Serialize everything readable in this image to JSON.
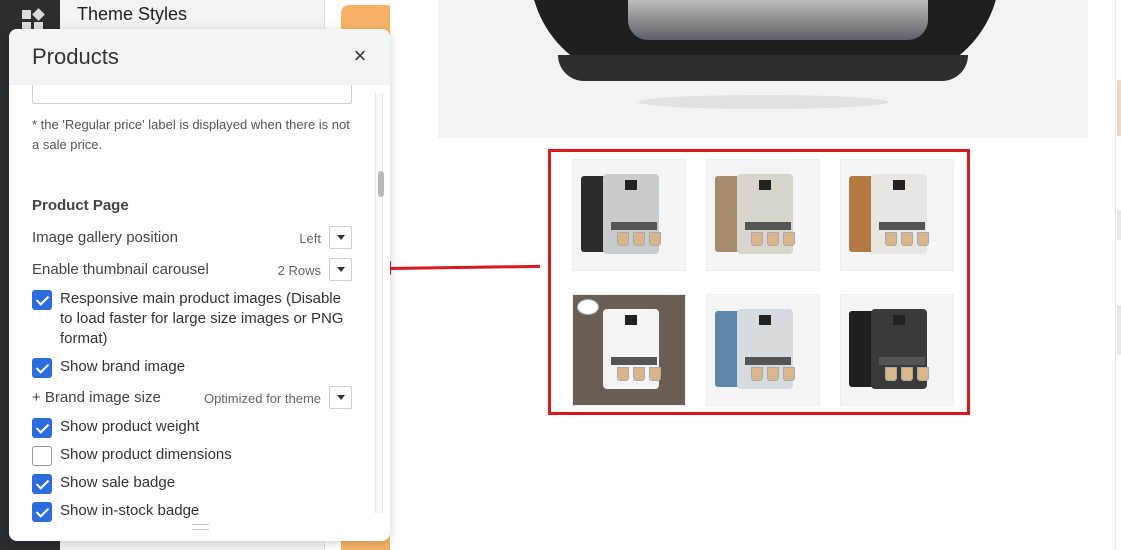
{
  "background": {
    "theme_styles_title": "Theme Styles"
  },
  "panel": {
    "title": "Products",
    "close_label": "×",
    "note": "* the 'Regular price' label is displayed when there is not a sale price.",
    "section_title": "Product Page",
    "rows": {
      "image_gallery_position": {
        "label": "Image gallery position",
        "value": "Left"
      },
      "enable_thumbnail_carousel": {
        "label": "Enable thumbnail carousel",
        "value": "2 Rows"
      },
      "brand_image_size": {
        "label": "+ Brand image size",
        "value": "Optimized for theme"
      }
    },
    "checkboxes": {
      "responsive_images": {
        "label": "Responsive main product images (Disable to load faster for large size images or PNG format)",
        "checked": true
      },
      "show_brand_image": {
        "label": "Show brand image",
        "checked": true
      },
      "show_product_weight": {
        "label": "Show product weight",
        "checked": true
      },
      "show_product_dimensions": {
        "label": "Show product dimensions",
        "checked": false
      },
      "show_sale_badge": {
        "label": "Show sale badge",
        "checked": true
      },
      "show_in_stock_badge": {
        "label": "Show in-stock badge",
        "checked": true
      }
    }
  },
  "thumbnails": [
    {
      "name": "black-silver-machine",
      "body_color": "#c9cccf",
      "side_color": "#2b2b2b"
    },
    {
      "name": "bronze-machine",
      "body_color": "#d9d4cc",
      "side_color": "#a88a6c"
    },
    {
      "name": "copper-machine",
      "body_color": "#e9e6e2",
      "side_color": "#b57a44"
    },
    {
      "name": "white-brown-machine",
      "body_color": "#f4f4f4",
      "side_color": "#6b5f55"
    },
    {
      "name": "blue-machine",
      "body_color": "#d6dbe0",
      "side_color": "#5d86a8"
    },
    {
      "name": "dark-chrome-machine",
      "body_color": "#3a3a3a",
      "side_color": "#1f1f1f"
    }
  ],
  "colors": {
    "accent_blue": "#2d6cdf",
    "highlight_red": "#d9191f",
    "strip_orange": "#f6b266"
  }
}
